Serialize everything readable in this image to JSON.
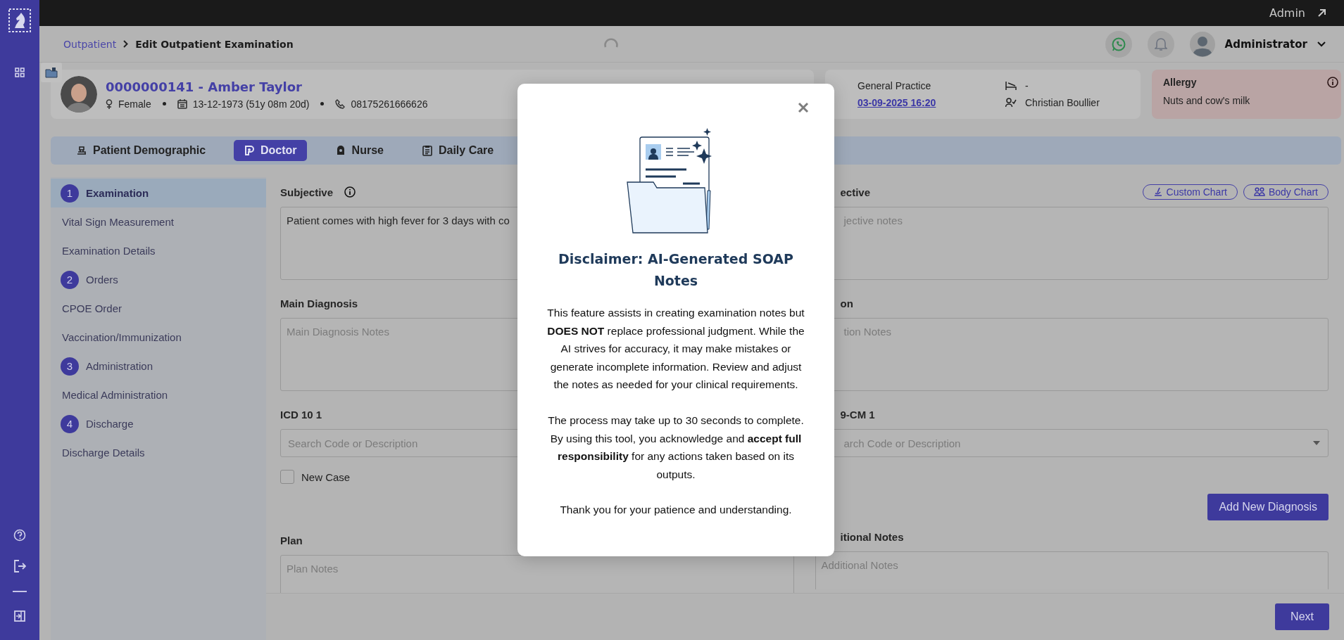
{
  "top_bar": {
    "user": "Admin"
  },
  "breadcrumb": [
    {
      "label": "Outpatient",
      "kind": "link"
    },
    {
      "label": "Edit Outpatient Examination",
      "kind": "current"
    }
  ],
  "header": {
    "user_name": "Administrator"
  },
  "patient": {
    "title": "0000000141 - Amber Taylor",
    "gender": "Female",
    "birth": "13-12-1973 (51y 08m 20d)",
    "phone": "08175261666626"
  },
  "visit": {
    "department": "General Practice",
    "date": "03-09-2025 16:20",
    "bed": "-",
    "doctor": "Christian Boullier"
  },
  "allergy": {
    "title": "Allergy",
    "text": "Nuts and cow's milk"
  },
  "tabs": [
    {
      "label": "Patient Demographic",
      "selected": false
    },
    {
      "label": "Doctor",
      "selected": true
    },
    {
      "label": "Nurse",
      "selected": false
    },
    {
      "label": "Daily Care",
      "selected": false
    }
  ],
  "steps": [
    {
      "kind": "step",
      "number": "1",
      "label": "Examination",
      "selected": true
    },
    {
      "kind": "sub",
      "label": "Vital Sign Measurement",
      "selected": false
    },
    {
      "kind": "sub",
      "label": "Examination Details",
      "selected": false
    },
    {
      "kind": "step",
      "number": "2",
      "label": "Orders",
      "selected": false
    },
    {
      "kind": "sub",
      "label": "CPOE Order",
      "selected": false
    },
    {
      "kind": "sub",
      "label": "Vaccination/Immunization",
      "selected": false
    },
    {
      "kind": "step",
      "number": "3",
      "label": "Administration",
      "selected": false
    },
    {
      "kind": "sub",
      "label": "Medical Administration",
      "selected": false
    },
    {
      "kind": "step",
      "number": "4",
      "label": "Discharge",
      "selected": false
    },
    {
      "kind": "sub",
      "label": "Discharge Details",
      "selected": false
    }
  ],
  "form": {
    "subjective": {
      "label": "Subjective",
      "value": "Patient comes with high fever for 3 days with co"
    },
    "objective": {
      "label": "ective",
      "placeholder": "jective notes",
      "chart_buttons": [
        "Custom Chart",
        "Body Chart"
      ]
    },
    "main_diagnosis": {
      "label": "Main Diagnosis",
      "placeholder": "Main Diagnosis Notes"
    },
    "column_2_row_2": {
      "label": "on",
      "placeholder": "tion Notes"
    },
    "icd10": {
      "label": "ICD 10 1",
      "placeholder": "Search Code or Description"
    },
    "icd9": {
      "label": "9-CM 1",
      "placeholder": "arch Code or Description"
    },
    "new_case": {
      "label": "New Case",
      "checked": false
    },
    "add_button": "Add New Diagnosis",
    "plan": {
      "label": "Plan",
      "placeholder": "Plan Notes"
    },
    "additional": {
      "label": "itional Notes",
      "placeholder": "Additional Notes"
    }
  },
  "footer": {
    "next": "Next"
  },
  "modal": {
    "title": "Disclaimer: AI-Generated SOAP Notes",
    "paragraphs": [
      "This feature assists in creating examination notes but **DOES NOT** replace professional judgment. While the AI strives for accuracy, it may make mistakes or generate incomplete information. Review and adjust the notes as needed for your clinical requirements.",
      "The process may take up to 30 seconds to complete. By using this tool, you acknowledge and **accept full responsibility** for any actions taken based on its outputs.",
      "Thank you for your patience and understanding."
    ]
  }
}
